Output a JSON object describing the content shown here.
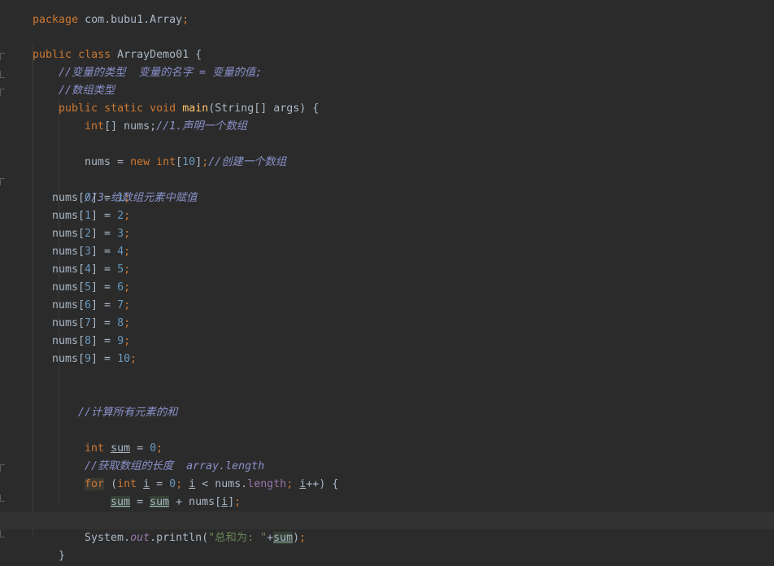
{
  "code": {
    "package_kw": "package",
    "package_name": " com.bubu1.Array",
    "public": "public",
    "class": "class",
    "class_name": "ArrayDemo01",
    "comment1": "//变量的类型  变量的名字 = 变量的值;",
    "comment2": "//数组类型",
    "static": "static",
    "void": "void",
    "main": "main",
    "main_params": "(String[] args) {",
    "int": "int",
    "decl_nums": "[] nums;",
    "comment_declare": "//1.声明一个数组",
    "nums_assign": "nums = ",
    "new": "new",
    "create_size": "10",
    "comment_create": "//创建一个数组",
    "comment_assign": "//3.给数组元素中赋值",
    "assignments": [
      {
        "idx": "0",
        "val": "1"
      },
      {
        "idx": "1",
        "val": "2"
      },
      {
        "idx": "2",
        "val": "3"
      },
      {
        "idx": "3",
        "val": "4"
      },
      {
        "idx": "4",
        "val": "5"
      },
      {
        "idx": "5",
        "val": "6"
      },
      {
        "idx": "6",
        "val": "7"
      },
      {
        "idx": "7",
        "val": "8"
      },
      {
        "idx": "8",
        "val": "9"
      },
      {
        "idx": "9",
        "val": "10"
      }
    ],
    "comment_sum": "//计算所有元素的和",
    "sum": "sum",
    "zero": "0",
    "comment_length": "//获取数组的长度  array.length",
    "for": "for",
    "i": "i",
    "nums_length_a": " < nums.",
    "length": "length",
    "plus_plus": "++) {",
    "nums_bracket": " + nums[",
    "close_brace": "}",
    "system": "System.",
    "out": "out",
    "println": ".println(",
    "string_total": "\"总和为: \"",
    "plus": "+"
  }
}
